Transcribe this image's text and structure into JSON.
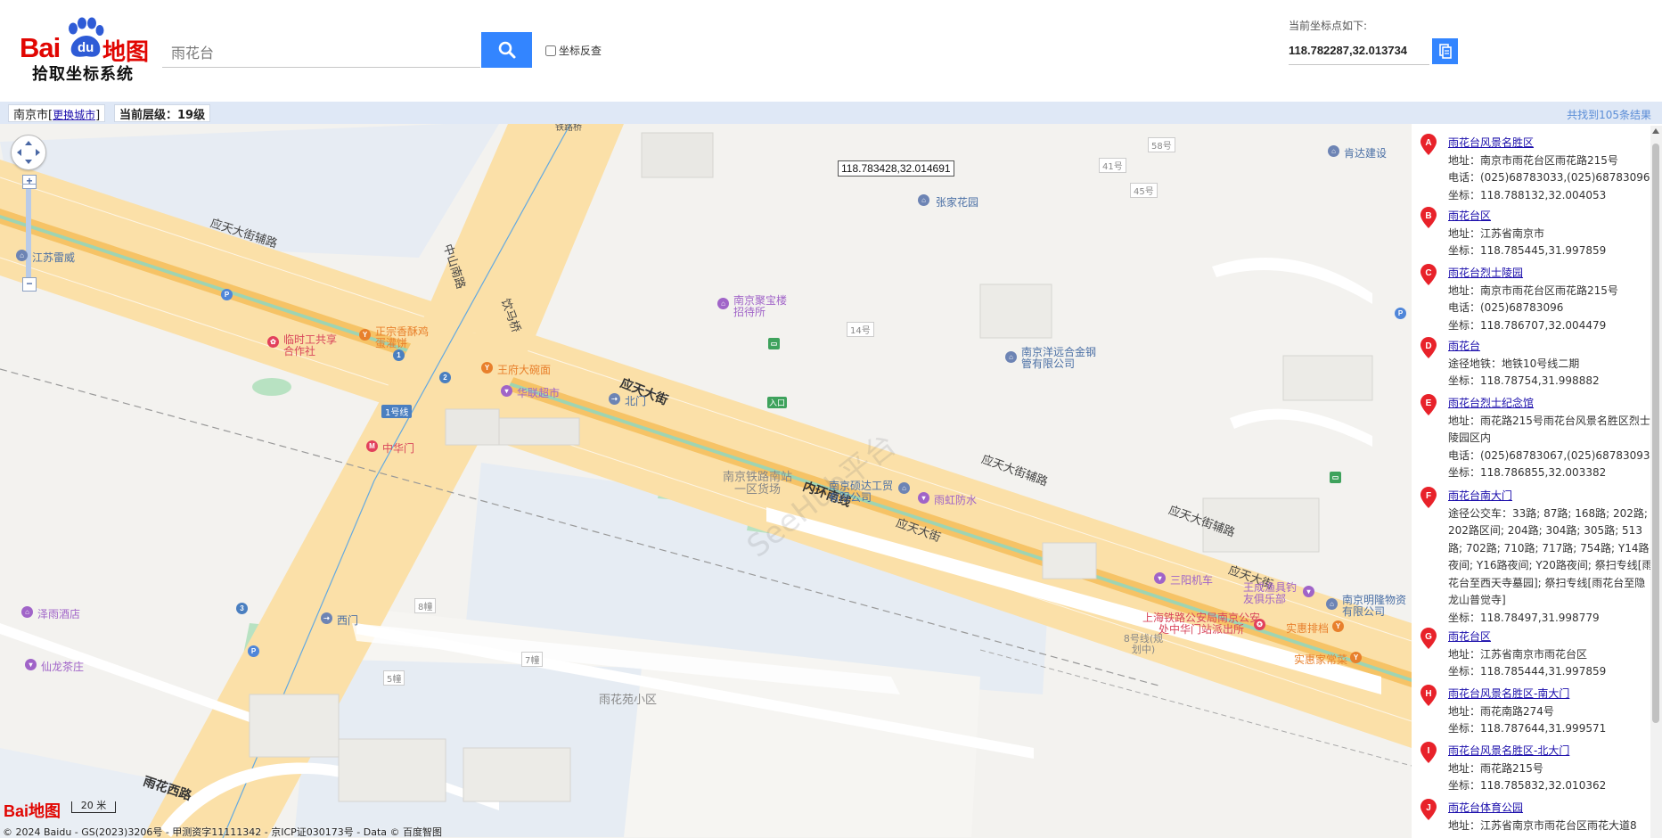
{
  "header": {
    "logo_word": "Bai",
    "logo_du": "du",
    "logo_cn": "地图",
    "logo_subtitle": "拾取坐标系统",
    "search_value": "雨花台",
    "reverse_label": "坐标反查",
    "current_coord_label": "当前坐标点如下:",
    "current_coord_value": "118.782287,32.013734"
  },
  "infobar": {
    "city": "南京市",
    "change_city": "更换城市",
    "level_label": "当前层级：19级",
    "results_count": "共找到105条结果"
  },
  "map": {
    "coord_tooltip": "118.783428,32.014691",
    "watermark": "SeeHub平台",
    "copyright": "© 2024 Baidu - GS(2023)3206号 - 甲测资字11111342 - 京ICP证030173号 - Data © 百度智图",
    "scale_label": "20 米",
    "mini_logo": "Bai地图",
    "roads": {
      "yingtian_main": "应天大街",
      "yingtian_aux_nw": "应天大街辅路",
      "zhongshan_south": "中山南路",
      "yinma_bridge": "饮马桥",
      "neihuan_south": "内环南线",
      "yingtian_aux_e": "应天大街辅路",
      "yingtian_e": "应天大街",
      "yingtian_aux_far": "应天大街辅路",
      "yingtian_far": "应天大街",
      "yuhua_west": "雨花西路",
      "line1": "1号线",
      "tieluqiao": "铁路桥"
    },
    "labels": {
      "zhangjia_garden": "张家花园",
      "kenda": "肯达建设",
      "jiangsu_leiwei": "江苏雷威",
      "linshi": "临时工共享合作社",
      "zhengzong": "正宗香酥鸡蛋灌饼",
      "wangfu": "王府大碗面",
      "hualian": "华联超市",
      "beimen": "北门",
      "zhonghuamen": "中华门",
      "juba": "南京聚宝楼招待所",
      "yangyuan": "南京洋远合金钢管有限公司",
      "tielu_south": "南京铁路南站一区货场",
      "shuoda": "南京硕达工贸有限公司",
      "yuhong": "雨虹防水",
      "sanyang": "三阳机车",
      "wangcheng": "王成渔具钓友俱乐部",
      "minglong": "南京明隆物资有限公司",
      "police": "上海铁路公安局南京公安处中华门站派出所",
      "shihui_cart": "实惠排档",
      "shihui_vegetable": "实惠家常菜",
      "zeyu_hotel": "泽雨酒店",
      "ximen": "西门",
      "xianlong_tea": "仙龙茶庄",
      "yuhuayuan": "雨花苑小区",
      "line8_plan": "8号线(规划中)",
      "b58": "58号",
      "b41": "41号",
      "b45": "45号",
      "b14": "14号",
      "b8": "8幢",
      "b7": "7幢",
      "b5": "5幢",
      "exit1": "1",
      "exit2": "2",
      "exit3": "3",
      "entrance": "入口"
    }
  },
  "results": [
    {
      "letter": "A",
      "title": "雨花台风景名胜区",
      "lines": [
        "地址：南京市雨花台区雨花路215号",
        "电话：(025)68783033,(025)68783096",
        "坐标：118.788132,32.004053"
      ]
    },
    {
      "letter": "B",
      "title": "雨花台区",
      "lines": [
        "地址：江苏省南京市",
        "坐标：118.785445,31.997859"
      ]
    },
    {
      "letter": "C",
      "title": "雨花台烈士陵园",
      "lines": [
        "地址：南京市雨花台区雨花路215号",
        "电话：(025)68783096",
        "坐标：118.786707,32.004479"
      ]
    },
    {
      "letter": "D",
      "title": "雨花台",
      "lines": [
        "途径地铁：地铁10号线二期",
        "坐标：118.78754,31.998882"
      ]
    },
    {
      "letter": "E",
      "title": "雨花台烈士纪念馆",
      "lines": [
        "地址：雨花路215号雨花台风景名胜区烈士陵园区内",
        "电话：(025)68783067,(025)68783093",
        "坐标：118.786855,32.003382"
      ]
    },
    {
      "letter": "F",
      "title": "雨花台南大门",
      "lines": [
        "途径公交车：33路; 87路; 168路; 202路; 202路区间; 204路; 304路; 305路; 513路; 702路; 710路; 717路; 754路; Y14路夜间; Y16路夜间; Y20路夜间; 祭扫专线[雨花台至西天寺墓园]; 祭扫专线[雨花台至隐龙山普觉寺]",
        "坐标：118.78497,31.998779"
      ]
    },
    {
      "letter": "G",
      "title": "雨花台区",
      "lines": [
        "地址：江苏省南京市雨花台区",
        "坐标：118.785444,31.997859"
      ]
    },
    {
      "letter": "H",
      "title": "雨花台风景名胜区-南大门",
      "lines": [
        "地址：雨花南路274号",
        "坐标：118.787644,31.999571"
      ]
    },
    {
      "letter": "I",
      "title": "雨花台风景名胜区-北大门",
      "lines": [
        "地址：雨花路215号",
        "坐标：118.785832,32.010362"
      ]
    },
    {
      "letter": "J",
      "title": "雨花台体育公园",
      "lines": [
        "地址：江苏省南京市雨花台区雨花大道8"
      ]
    }
  ],
  "colors": {
    "accent": "#3385ff",
    "logo_red": "#e10602",
    "marker_red": "#e8222a",
    "road_main": "#fbe0a8",
    "road_center": "#f6c366",
    "water": "#a8d1ec",
    "green": "#a8dbb8",
    "infobar": "#dfe8f6"
  }
}
